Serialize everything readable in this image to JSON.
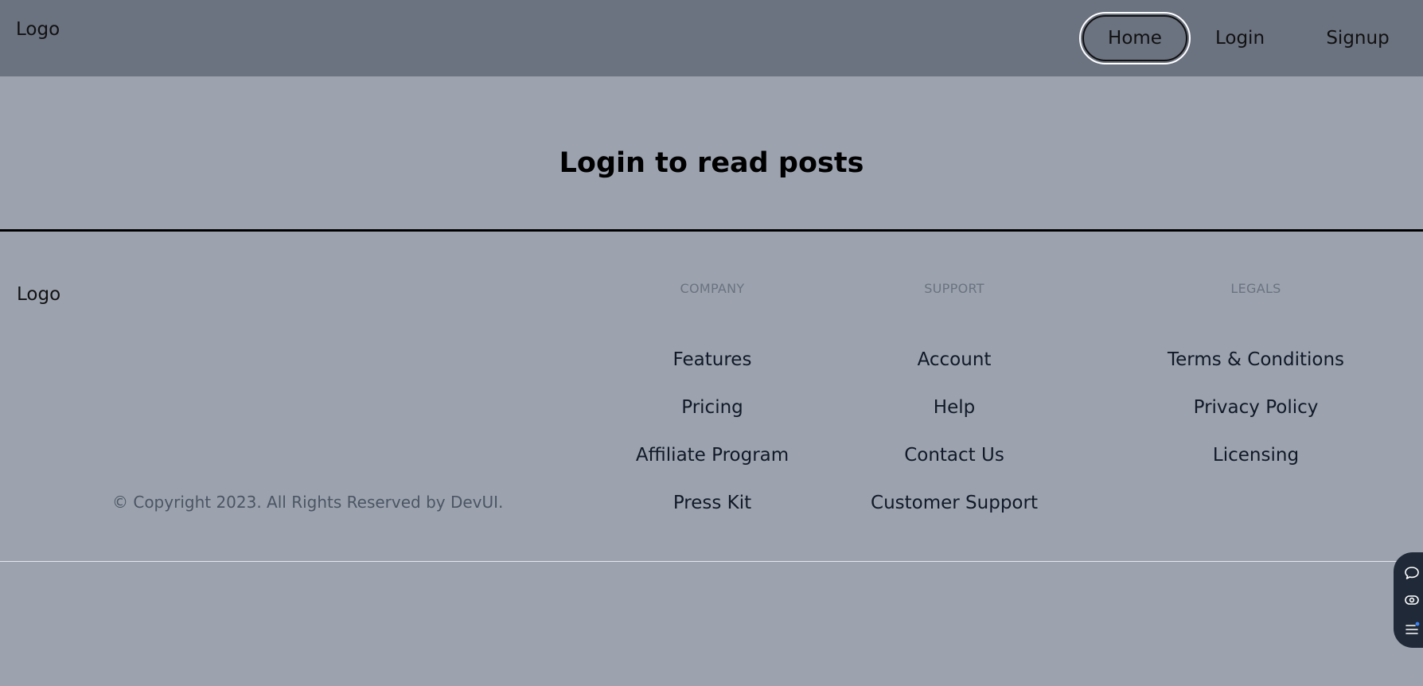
{
  "header": {
    "logo": "Logo",
    "nav": {
      "home": "Home",
      "login": "Login",
      "signup": "Signup"
    }
  },
  "main": {
    "title": "Login to read posts"
  },
  "footer": {
    "logo": "Logo",
    "copyright": "© Copyright 2023. All Rights Reserved by DevUI.",
    "columns": [
      {
        "heading": "COMPANY",
        "links": [
          "Features",
          "Pricing",
          "Affiliate Program",
          "Press Kit"
        ]
      },
      {
        "heading": "SUPPORT",
        "links": [
          "Account",
          "Help",
          "Contact Us",
          "Customer Support"
        ]
      },
      {
        "heading": "LEGALS",
        "links": [
          "Terms & Conditions",
          "Privacy Policy",
          "Licensing"
        ]
      }
    ]
  },
  "widget": {
    "icons": [
      "chat-icon",
      "eye-toggle-icon",
      "menu-notification-icon"
    ],
    "accent": "#3b82f6"
  },
  "colors": {
    "navbar": "#6b7280",
    "background": "#9ca3af",
    "widget": "#1f2937"
  }
}
